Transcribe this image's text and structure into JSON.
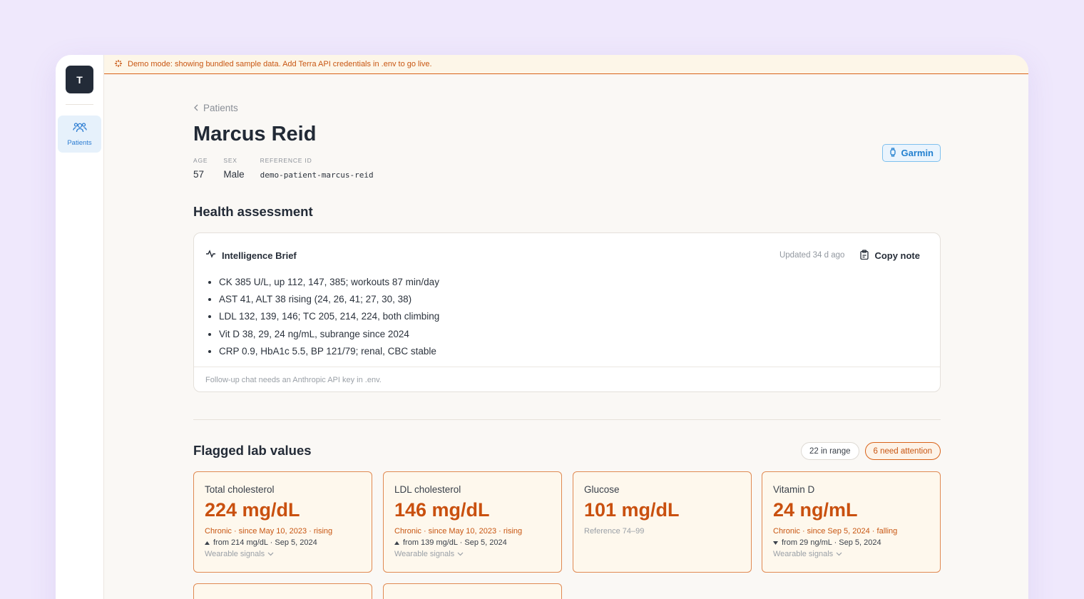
{
  "sidebar": {
    "logo": "T",
    "nav": [
      {
        "label": "Patients",
        "icon": "users-icon"
      }
    ]
  },
  "banner": {
    "text": "Demo mode: showing bundled sample data. Add Terra API credentials in .env to go live."
  },
  "breadcrumb": {
    "label": "Patients"
  },
  "patient": {
    "name": "Marcus Reid",
    "age_label": "AGE",
    "age": "57",
    "sex_label": "SEX",
    "sex": "Male",
    "ref_label": "REFERENCE ID",
    "ref": "demo-patient-marcus-reid",
    "device": "Garmin"
  },
  "assessment": {
    "heading": "Health assessment",
    "brief_title": "Intelligence Brief",
    "updated": "Updated 34 d ago",
    "copy_label": "Copy note",
    "bullets": [
      "CK 385 U/L, up 112, 147, 385; workouts 87 min/day",
      "AST 41, ALT 38 rising (24, 26, 41; 27, 30, 38)",
      "LDL 132, 139, 146; TC 205, 214, 224, both climbing",
      "Vit D 38, 29, 24 ng/mL, subrange since 2024",
      "CRP 0.9, HbA1c 5.5, BP 121/79; renal, CBC stable"
    ],
    "footer": "Follow-up chat needs an Anthropic API key in .env."
  },
  "labs": {
    "heading": "Flagged lab values",
    "in_range": "22 in range",
    "attention": "6 need attention",
    "cards": [
      {
        "name": "Total cholesterol",
        "value": "224 mg/dL",
        "status": "Chronic · since May 10, 2023 · rising",
        "trend": "up",
        "from": "from 214 mg/dL · Sep 5, 2024",
        "wearable": "Wearable signals"
      },
      {
        "name": "LDL cholesterol",
        "value": "146 mg/dL",
        "status": "Chronic · since May 10, 2023 · rising",
        "trend": "up",
        "from": "from 139 mg/dL · Sep 5, 2024",
        "wearable": "Wearable signals"
      },
      {
        "name": "Glucose",
        "value": "101 mg/dL",
        "reference": "Reference 74–99"
      },
      {
        "name": "Vitamin D",
        "value": "24 ng/mL",
        "status": "Chronic · since Sep 5, 2024 · falling",
        "trend": "down",
        "from": "from 29 ng/mL · Sep 5, 2024",
        "wearable": "Wearable signals"
      }
    ]
  },
  "colors": {
    "accent": "#c85612",
    "brand": "#2d7dd2",
    "background": "#efe8fc"
  }
}
